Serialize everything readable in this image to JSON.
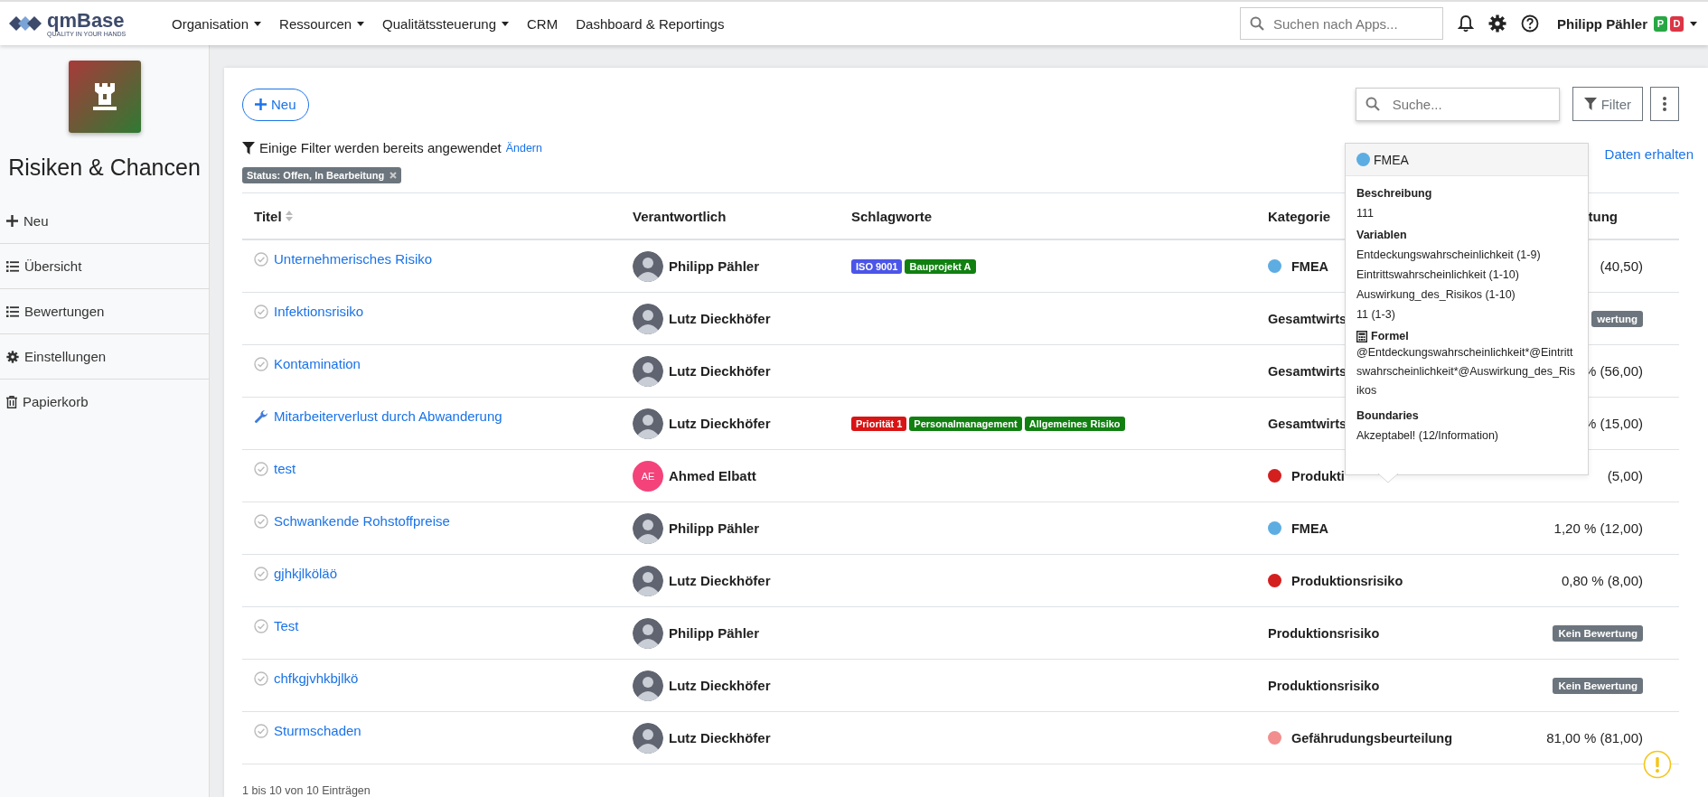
{
  "nav": {
    "logo": {
      "name": "qmBase",
      "tagline": "QUALITY IN YOUR HANDS"
    },
    "menus": [
      {
        "label": "Organisation",
        "dropdown": true
      },
      {
        "label": "Ressourcen",
        "dropdown": true
      },
      {
        "label": "Qualitätssteuerung",
        "dropdown": true
      },
      {
        "label": "CRM",
        "dropdown": false
      },
      {
        "label": "Dashboard & Reportings",
        "dropdown": false
      }
    ],
    "search": {
      "placeholder": "Suchen nach Apps..."
    },
    "user": {
      "name": "Philipp Pähler",
      "badges": [
        {
          "label": "P",
          "color": "#28a745"
        },
        {
          "label": "D",
          "color": "#dc3545"
        }
      ]
    }
  },
  "sidebar": {
    "title": "Risiken & Chancen",
    "items": [
      {
        "label": "Neu",
        "kind": "new"
      },
      {
        "label": "Übersicht",
        "kind": "list"
      },
      {
        "label": "Bewertungen",
        "kind": "list"
      },
      {
        "label": "Einstellungen",
        "kind": "settings"
      },
      {
        "label": "Papierkorb",
        "kind": "trash"
      }
    ]
  },
  "toolbar": {
    "new_button": "Neu",
    "search": {
      "placeholder": "Suche..."
    },
    "filter_button": "Filter"
  },
  "filter_notice": {
    "text": "Einige Filter werden bereits angewendet",
    "link": "Ändern",
    "chips": [
      "Status: Offen, In Bearbeitung"
    ]
  },
  "data_link": "Daten erhalten",
  "table": {
    "columns": [
      "Titel",
      "Verantwortlich",
      "Schlagworte",
      "Kategorie",
      "tung"
    ],
    "rows": [
      {
        "title": "Unternehmerisches Risiko",
        "in_progress": false,
        "owner": {
          "name": "Philipp Pähler"
        },
        "tags": [
          {
            "label": "ISO 9001",
            "color": "#4b55e8"
          },
          {
            "label": "Bauprojekt A",
            "color": "#118011"
          }
        ],
        "category": {
          "label": "FMEA",
          "color": "#5dade2"
        },
        "rating": {
          "kind": "value",
          "text": "(40,50)"
        }
      },
      {
        "title": "Infektionsrisiko",
        "in_progress": false,
        "owner": {
          "name": "Lutz Dieckhöfer"
        },
        "tags": [],
        "category": {
          "label": "Gesamtwirts"
        },
        "rating": {
          "kind": "badge",
          "text": "wertung"
        }
      },
      {
        "title": "Kontamination",
        "in_progress": false,
        "owner": {
          "name": "Lutz Dieckhöfer"
        },
        "tags": [],
        "category": {
          "label": "Gesamtwirts"
        },
        "rating": {
          "kind": "value",
          "text": "% (56,00)"
        }
      },
      {
        "title": "Mitarbeiterverlust durch Abwanderung",
        "in_progress": true,
        "owner": {
          "name": "Lutz Dieckhöfer"
        },
        "tags": [
          {
            "label": "Priorität 1",
            "color": "#d91414"
          },
          {
            "label": "Personalmanagement",
            "color": "#118011"
          },
          {
            "label": "Allgemeines Risiko",
            "color": "#118011"
          }
        ],
        "category": {
          "label": "Gesamtwirts"
        },
        "rating": {
          "kind": "value",
          "text": "% (15,00)"
        }
      },
      {
        "title": "test",
        "in_progress": false,
        "owner": {
          "name": "Ahmed Elbatt",
          "initials": "AE",
          "color": "#f4437b"
        },
        "tags": [],
        "category": {
          "label": "Produkti",
          "color": "#d41f1f"
        },
        "rating": {
          "kind": "value",
          "text": "(5,00)"
        }
      },
      {
        "title": "Schwankende Rohstoffpreise",
        "in_progress": false,
        "owner": {
          "name": "Philipp Pähler"
        },
        "tags": [],
        "category": {
          "label": "FMEA",
          "color": "#5dade2"
        },
        "rating": {
          "kind": "value",
          "text": "1,20 % (12,00)"
        }
      },
      {
        "title": "gjhkjlköläö",
        "in_progress": false,
        "owner": {
          "name": "Lutz Dieckhöfer"
        },
        "tags": [],
        "category": {
          "label": "Produktionsrisiko",
          "color": "#d41f1f"
        },
        "rating": {
          "kind": "value",
          "text": "0,80 % (8,00)"
        }
      },
      {
        "title": "Test",
        "in_progress": false,
        "owner": {
          "name": "Philipp Pähler"
        },
        "tags": [],
        "category": {
          "label": "Produktionsrisiko"
        },
        "rating": {
          "kind": "badge",
          "text": "Kein Bewertung"
        }
      },
      {
        "title": "chfkgjvhkbjlkö",
        "in_progress": false,
        "owner": {
          "name": "Lutz Dieckhöfer"
        },
        "tags": [],
        "category": {
          "label": "Produktionsrisiko"
        },
        "rating": {
          "kind": "badge",
          "text": "Kein Bewertung"
        }
      },
      {
        "title": "Sturmschaden",
        "in_progress": false,
        "owner": {
          "name": "Lutz Dieckhöfer"
        },
        "tags": [],
        "category": {
          "label": "Gefährudungsbeurteilung",
          "color": "#f28e8e"
        },
        "rating": {
          "kind": "value",
          "text": "81,00 % (81,00)"
        }
      }
    ]
  },
  "tooltip": {
    "title": "FMEA",
    "color": "#5dade2",
    "sections": [
      {
        "heading": "Beschreibung",
        "kind": "text",
        "lines": [
          "111"
        ]
      },
      {
        "heading": "Variablen",
        "kind": "text",
        "lines": [
          "Entdeckungswahrscheinlichkeit (1-9)",
          "Eintrittswahrscheinlichkeit (1-10)",
          "Auswirkung_des_Risikos (1-10)",
          "11 (1-3)"
        ]
      },
      {
        "heading": "Formel",
        "kind": "formula",
        "lines": [
          "@Entdeckungswahrscheinlichkeit*@Eintrittswahrscheinlichkeit*@Auswirkung_des_Risikos"
        ]
      },
      {
        "heading": "Boundaries",
        "kind": "text",
        "lines": [
          "Akzeptabel! (12/Information)"
        ]
      }
    ]
  },
  "footer": "1 bis 10 von 10 Einträgen"
}
